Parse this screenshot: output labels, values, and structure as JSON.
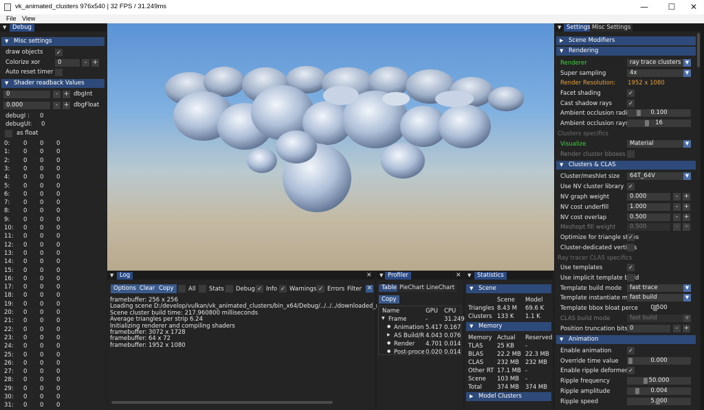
{
  "window": {
    "title": "vk_animated_clusters 976x540 | 32 FPS / 31.249ms",
    "minimize": "—",
    "maximize": "☐",
    "close": "✕"
  },
  "menu": [
    "File",
    "View"
  ],
  "debug": {
    "tab": "Debug",
    "misc_header": "Misc settings",
    "draw_objects": "draw objects",
    "colorize_xor": "Colorize xor",
    "colorize_xor_value": "0",
    "auto_reset_timer": "Auto reset timer",
    "readback_header": "Shader readback Values",
    "dbgInt_value": "0",
    "dbgInt_label": "dbgInt",
    "dbgFloat_value": "0.000",
    "dbgFloat_label": "dbgFloat",
    "debugI": "debugI :",
    "debugI_value": "0",
    "debugUI": "debugUI:",
    "debugUI_value": "0",
    "as_float": "as float",
    "rows": [
      "0:",
      "1:",
      "2:",
      "3:",
      "4:",
      "5:",
      "6:",
      "7:",
      "8:",
      "9:",
      "10:",
      "11:",
      "12:",
      "13:",
      "14:",
      "15:",
      "16:",
      "17:",
      "18:",
      "19:",
      "20:",
      "21:",
      "22:",
      "23:",
      "24:",
      "25:",
      "26:",
      "27:",
      "28:",
      "29:",
      "30:",
      "31:"
    ],
    "zero": "0"
  },
  "log": {
    "tab": "Log",
    "options": "Options",
    "clear": "Clear",
    "copy": "Copy",
    "filters": [
      "All",
      "Stats",
      "Debug",
      "Info",
      "Warnings",
      "Errors"
    ],
    "filter_label": "Filter",
    "lines": [
      "framebuffer: 256 x 256",
      "Loading scene D:/develop/vulkan/vk_animated_clusters/bin_x64/Debug/../../../downloaded_resources//bu",
      "Scene cluster build time: 217.960800 milliseconds",
      "Average triangles per strip 6.24",
      "Initializing renderer and compiling shaders",
      "framebuffer: 3072 x 1728",
      "framebuffer: 64 x 72",
      "framebuffer: 1952 x 1080"
    ]
  },
  "profiler": {
    "tab": "Profiler",
    "subtabs": [
      "Table",
      "PieChart",
      "LineChart"
    ],
    "copy": "Copy",
    "headers": [
      "Name",
      "GPU",
      "CPU"
    ],
    "rows": [
      {
        "name": "Frame",
        "gpu": "-",
        "cpu": "31.249"
      },
      {
        "name": "Animation",
        "gpu": "5.417",
        "cpu": "0.167"
      },
      {
        "name": "AS Build/R",
        "gpu": "4.043",
        "cpu": "0.076"
      },
      {
        "name": "Render",
        "gpu": "4.701",
        "cpu": "0.014"
      },
      {
        "name": "Post-proce",
        "gpu": "0.020",
        "cpu": "0.014"
      }
    ]
  },
  "statistics": {
    "tab": "Statistics",
    "scene_header": "Scene",
    "scene_cols": [
      "Scene",
      "Model"
    ],
    "triangles": [
      "Triangles",
      "8.43 M",
      "69.6 K"
    ],
    "clusters": [
      "Clusters",
      "133 K",
      "1.1 K"
    ],
    "memory_header": "Memory",
    "mem_cols": [
      "Memory",
      "Actual",
      "Reserved"
    ],
    "mem_rows": [
      [
        "TLAS",
        "25 KB",
        "-"
      ],
      [
        "BLAS",
        "22.2 MB",
        "22.3 MB"
      ],
      [
        "CLAS",
        "232 MB",
        "232 MB"
      ],
      [
        "Other RT",
        "17.1 MB",
        "-"
      ],
      [
        "Scene",
        "103 MB",
        "-"
      ],
      [
        "Total",
        "374 MB",
        "374 MB"
      ]
    ],
    "model_clusters_header": "Model Clusters"
  },
  "settings": {
    "tabs": [
      "Settings",
      "Misc Settings"
    ],
    "scene_modifiers": "Scene Modifiers",
    "rendering": "Rendering",
    "renderer_label": "Renderer",
    "renderer_value": "ray trace clusters",
    "supersampling_label": "Super sampling",
    "supersampling_value": "4x",
    "render_res_label": "Render Resolution:",
    "render_res_value": "1952 x 1080",
    "facet_shading": "Facet shading",
    "cast_shadow": "Cast shadow rays",
    "ao_radius_label": "Ambient occlusion radius",
    "ao_radius_value": "0.100",
    "ao_rays_label": "Ambient occlusion rays",
    "ao_rays_value": "16",
    "clusters_specifics": "Clusters specifics",
    "visualize_label": "Visualize",
    "visualize_value": "Material",
    "render_cluster_bboxes": "Render cluster bboxes",
    "clusters_clas_header": "Clusters & CLAS",
    "meshlet_size_label": "Cluster/meshlet size",
    "meshlet_size_value": "64T_64V",
    "use_nv_lib": "Use NV cluster library",
    "nv_graph_weight": "NV graph weight",
    "nv_graph_weight_value": "0.000",
    "nv_cost_underfill": "NV cost underfill",
    "nv_cost_underfill_value": "1.000",
    "nv_cost_overlap": "NV cost overlap",
    "nv_cost_overlap_value": "0.500",
    "meshopt_fill_weight": "Meshopt fill weight",
    "meshopt_fill_weight_value": "0.500",
    "optimize_strips": "Optimize for triangle strips",
    "cluster_dedicated": "Cluster-dedicated vertices",
    "rt_clas_specifics": "Ray tracer CLAS specifics",
    "use_templates": "Use templates",
    "use_implicit": "Use implicit template build",
    "template_build_mode": "Template build mode",
    "template_build_mode_value": "fast trace",
    "template_inst_mode": "Template instantiate mode",
    "template_inst_mode_value": "fast build",
    "template_bbox": "Template bbox bloat perce",
    "template_bbox_value": "0.500",
    "clas_build_mode": "CLAS build mode",
    "clas_build_mode_value": "fast build",
    "pos_trunc_bits": "Position truncation bits",
    "pos_trunc_bits_value": "0",
    "animation_header": "Animation",
    "enable_animation": "Enable animation",
    "override_time": "Override time value",
    "override_time_value": "0.000",
    "enable_ripple": "Enable ripple deformer",
    "ripple_freq": "Ripple frequency",
    "ripple_freq_value": "50.000",
    "ripple_amp": "Ripple amplitude",
    "ripple_amp_value": "0.004",
    "ripple_speed": "Ripple speed",
    "ripple_speed_value": "5.000"
  },
  "colors": {
    "header_blue": "#2e4a7a",
    "tab_active": "#2a4a86",
    "accent_green": "#3fd13f",
    "accent_orange": "#e6a23c",
    "panel_bg": "#242424"
  }
}
